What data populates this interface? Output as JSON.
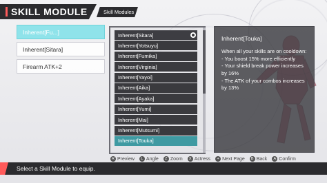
{
  "header": {
    "title": "SKILL MODULE",
    "breadcrumb": "Skill Modules"
  },
  "left_list": {
    "items": [
      {
        "label": "Inherent[Fu...]",
        "selected": true
      },
      {
        "label": "Inherent[Sitara]",
        "selected": false
      },
      {
        "label": "Firearm ATK+2",
        "selected": false
      }
    ]
  },
  "module_list": {
    "items": [
      {
        "label": "Inherent[Sitara]",
        "equipped": true
      },
      {
        "label": "Inherent[Yotsuyu]",
        "equipped": false
      },
      {
        "label": "Inherent[Fumika]",
        "equipped": false
      },
      {
        "label": "Inherent[Virginia]",
        "equipped": false
      },
      {
        "label": "Inherent[Yayoi]",
        "equipped": false
      },
      {
        "label": "Inherent[Aika]",
        "equipped": false
      },
      {
        "label": "Inherent[Ayaka]",
        "equipped": false
      },
      {
        "label": "Inherent[Yumi]",
        "equipped": false
      },
      {
        "label": "Inherent[Mai]",
        "equipped": false
      },
      {
        "label": "Inherent[Mutsumi]",
        "equipped": false
      },
      {
        "label": "Inherent[Touka]",
        "equipped": false,
        "highlighted": true
      }
    ]
  },
  "description": {
    "title": "Inherent[Touka]",
    "body": "When all your skills are on cooldown:\n- You boost 15% more efficiently\n- Your shield break power increases by 16%\n- The ATK of your combos increases by 13%"
  },
  "controls": [
    {
      "button": "R",
      "label": "Preview"
    },
    {
      "button": "L",
      "label": "Angle"
    },
    {
      "button": "Z",
      "label": "Zoom"
    },
    {
      "button": "X",
      "label": "Actress"
    },
    {
      "button": "+",
      "label": "Next Page"
    },
    {
      "button": "B",
      "label": "Back"
    },
    {
      "button": "A",
      "label": "Confirm"
    }
  ],
  "help_text": "Select a Skill Module to equip.",
  "colors": {
    "accent": "#ff5a5a",
    "selection": "#8fe3ea",
    "highlight": "#3f9aa2",
    "dark": "#2b2b2e"
  }
}
